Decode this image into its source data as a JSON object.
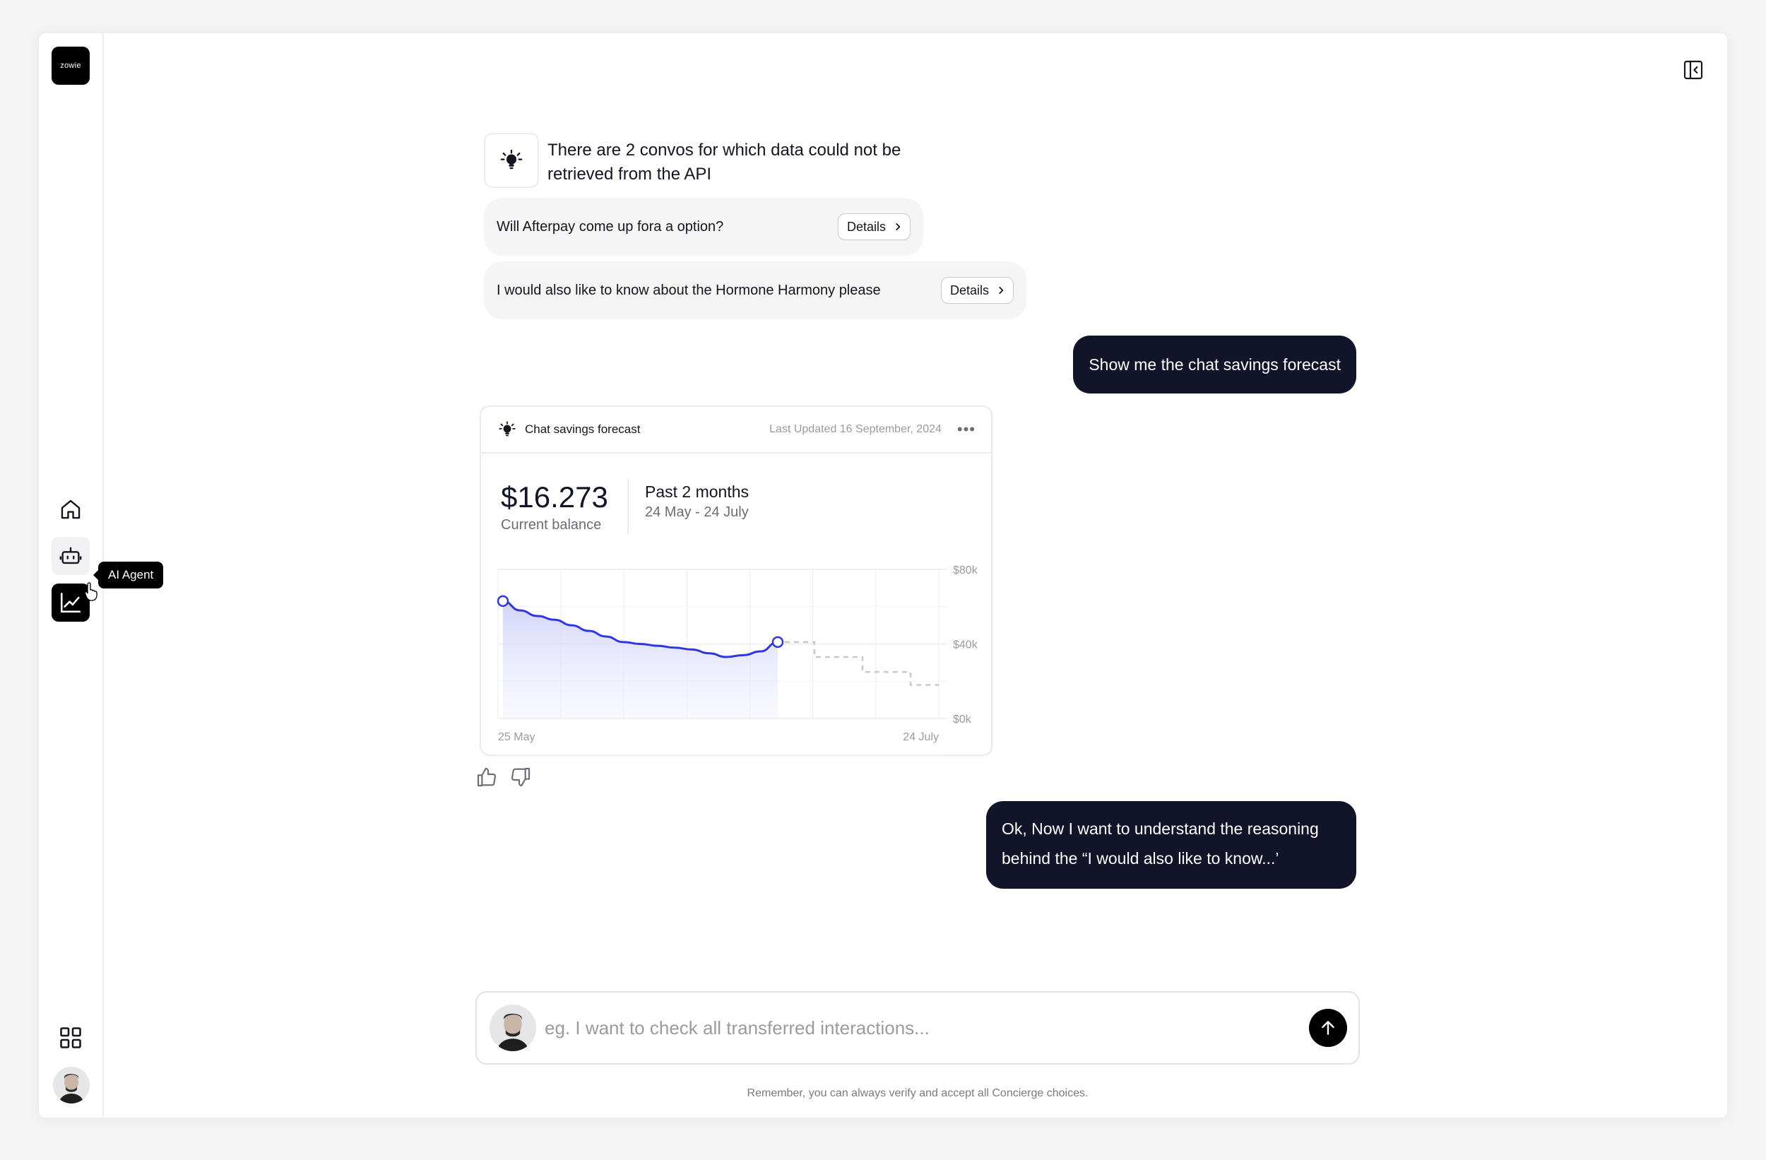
{
  "sidebar": {
    "logo_text": "zowie",
    "nav": [
      {
        "id": "home",
        "icon": "home-icon"
      },
      {
        "id": "ai-agent",
        "icon": "robot-icon"
      },
      {
        "id": "analytics",
        "icon": "chart-line-icon"
      }
    ],
    "tooltip": "AI Agent",
    "bottom_icon": "grid-icon"
  },
  "header": {
    "collapse_icon": "panel-collapse-icon"
  },
  "notice": {
    "icon": "lightbulb-icon",
    "text": "There are 2 convos for which data could not be retrieved from the API"
  },
  "convos": [
    {
      "text": "Will Afterpay come up fora a option?",
      "action": "Details"
    },
    {
      "text": "I would also like to know about the Hormone Harmony please",
      "action": "Details"
    }
  ],
  "messages": {
    "user_1": "Show me the chat savings forecast",
    "user_2": "Ok, Now I want to understand the reasoning behind the “I would also like to know...’"
  },
  "card": {
    "title": "Chat savings forecast",
    "updated": "Last Updated 16 September, 2024",
    "more_icon": "more-horizontal-icon",
    "balance": "$16.273",
    "balance_label": "Current balance",
    "period": "Past 2 months",
    "period_range": "24 May - 24 July"
  },
  "chart_data": {
    "type": "line",
    "x_labels": [
      "25 May",
      "24 July"
    ],
    "y_ticks": [
      "$80k",
      "$40k",
      "$0k"
    ],
    "ylim": [
      0,
      80
    ],
    "series": [
      {
        "values": [
          63,
          58,
          55,
          53,
          50,
          47,
          44,
          41,
          40,
          39,
          38,
          37,
          35,
          33,
          34,
          36,
          41
        ]
      },
      {
        "values": [
          41,
          41,
          33,
          33,
          25,
          25,
          18,
          18
        ]
      }
    ],
    "colors": {
      "line": "#2f36e4",
      "forecast": "#c8c8ce",
      "fill": "#dcdefb"
    }
  },
  "feedback": {
    "up": "thumbs-up-icon",
    "down": "thumbs-down-icon"
  },
  "composer": {
    "placeholder": "eg. I want to check all transferred interactions...",
    "send_icon": "arrow-up-icon"
  },
  "disclaimer": "Remember, you can always verify and accept all Concierge choices."
}
